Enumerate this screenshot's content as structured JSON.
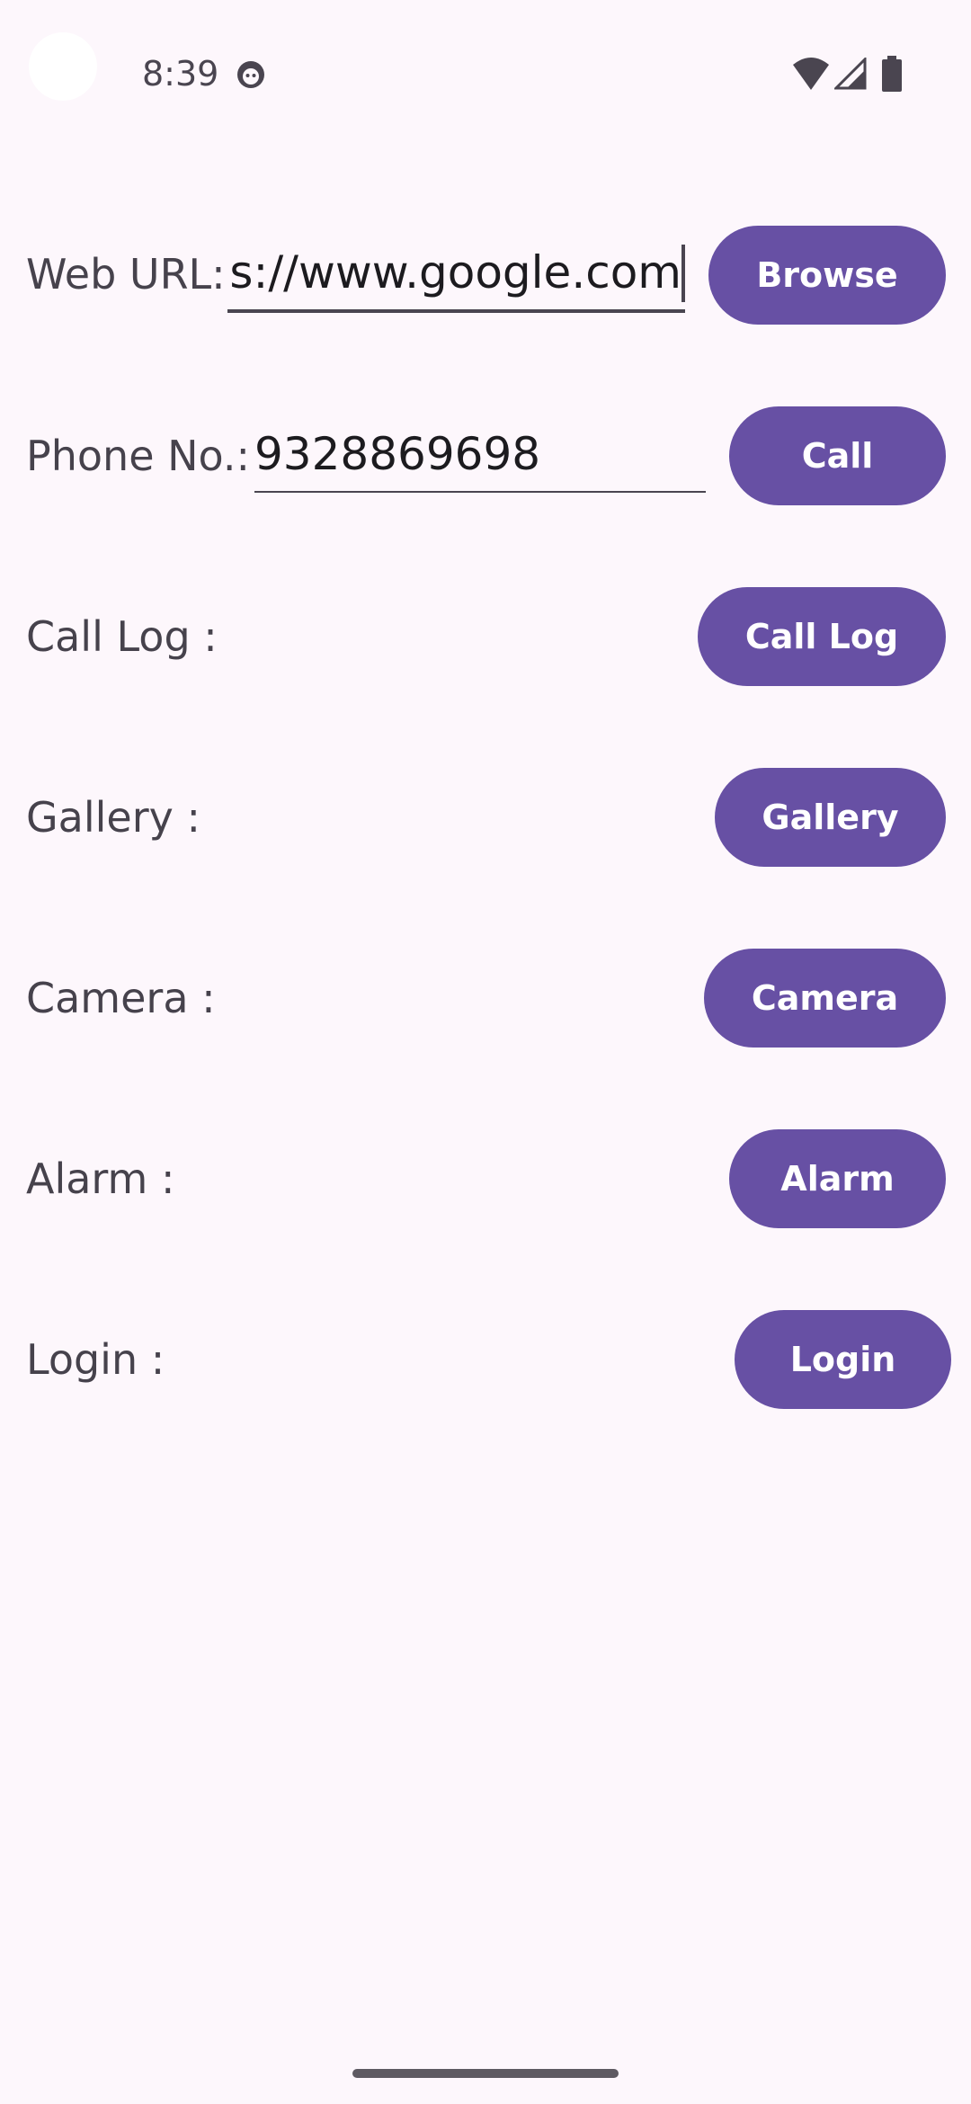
{
  "status_bar": {
    "time": "8:39",
    "icons": [
      "face-notification-icon",
      "wifi-icon",
      "signal-icon",
      "battery-icon"
    ]
  },
  "rows": {
    "web": {
      "label": "Web URL:",
      "value": "tps://www.google.com",
      "button": "Browse"
    },
    "phone": {
      "label": "Phone No.:",
      "value": "9328869698",
      "button": "Call"
    },
    "call_log": {
      "label": "Call Log :",
      "button": "Call Log"
    },
    "gallery": {
      "label": "Gallery :",
      "button": "Gallery"
    },
    "camera": {
      "label": "Camera :",
      "button": "Camera"
    },
    "alarm": {
      "label": "Alarm :",
      "button": "Alarm"
    },
    "login": {
      "label": "Login :",
      "button": "Login"
    }
  },
  "colors": {
    "background": "#fdf7fc",
    "button": "#6750a4",
    "button_text": "#ffffff",
    "label_text": "#46424c"
  }
}
